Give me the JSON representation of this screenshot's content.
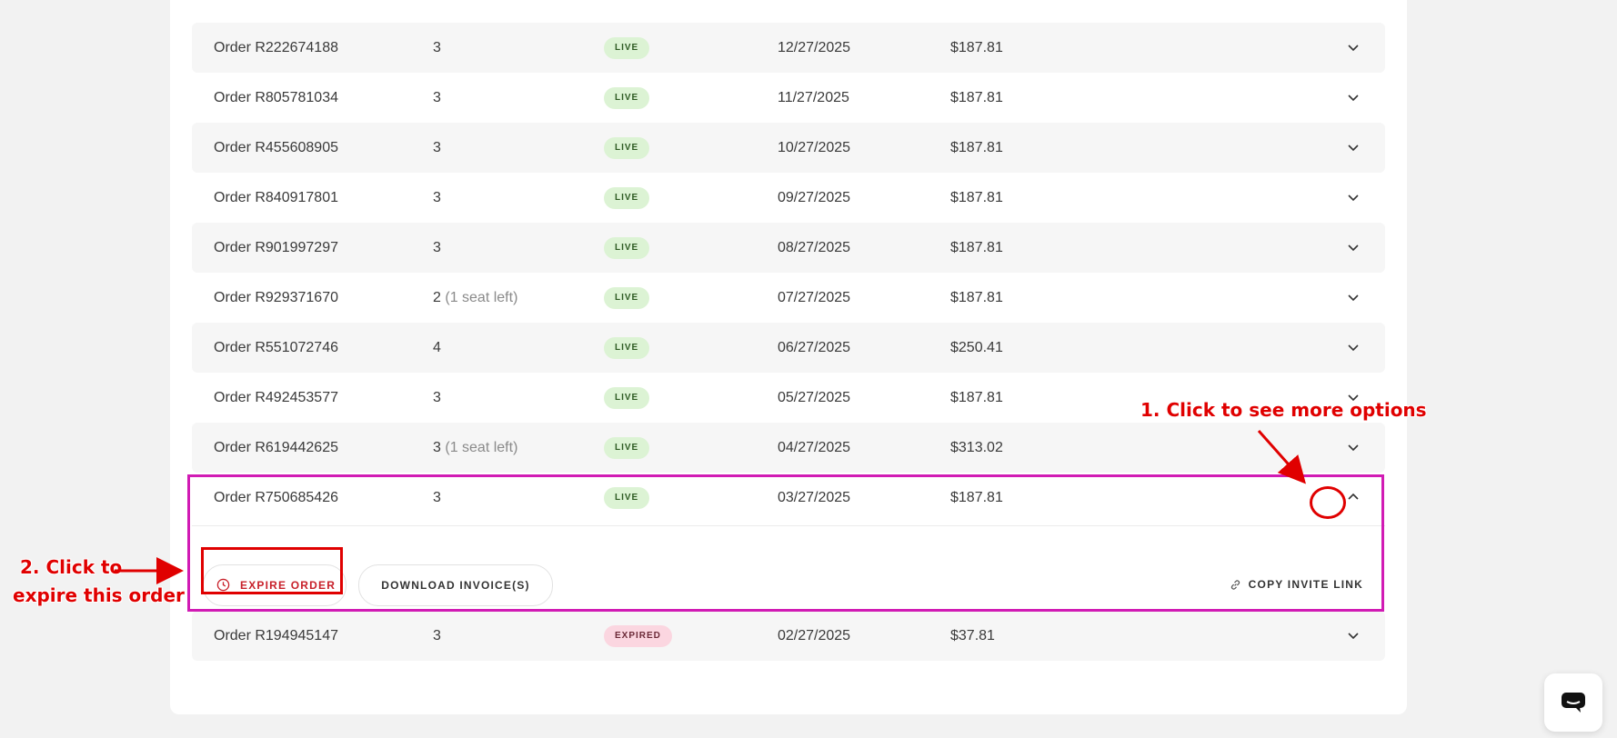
{
  "orders": [
    {
      "order": "Order R222674188",
      "seats": "3",
      "seats_left": "",
      "status": "LIVE",
      "date": "12/27/2025",
      "price": "$187.81"
    },
    {
      "order": "Order R805781034",
      "seats": "3",
      "seats_left": "",
      "status": "LIVE",
      "date": "11/27/2025",
      "price": "$187.81"
    },
    {
      "order": "Order R455608905",
      "seats": "3",
      "seats_left": "",
      "status": "LIVE",
      "date": "10/27/2025",
      "price": "$187.81"
    },
    {
      "order": "Order R840917801",
      "seats": "3",
      "seats_left": "",
      "status": "LIVE",
      "date": "09/27/2025",
      "price": "$187.81"
    },
    {
      "order": "Order R901997297",
      "seats": "3",
      "seats_left": "",
      "status": "LIVE",
      "date": "08/27/2025",
      "price": "$187.81"
    },
    {
      "order": "Order R929371670",
      "seats": "2",
      "seats_left": "(1 seat left)",
      "status": "LIVE",
      "date": "07/27/2025",
      "price": "$187.81"
    },
    {
      "order": "Order R551072746",
      "seats": "4",
      "seats_left": "",
      "status": "LIVE",
      "date": "06/27/2025",
      "price": "$250.41"
    },
    {
      "order": "Order R492453577",
      "seats": "3",
      "seats_left": "",
      "status": "LIVE",
      "date": "05/27/2025",
      "price": "$187.81"
    },
    {
      "order": "Order R619442625",
      "seats": "3",
      "seats_left": "(1 seat left)",
      "status": "LIVE",
      "date": "04/27/2025",
      "price": "$313.02"
    },
    {
      "order": "Order R750685426",
      "seats": "3",
      "seats_left": "",
      "status": "LIVE",
      "date": "03/27/2025",
      "price": "$187.81"
    },
    {
      "order": "Order R194945147",
      "seats": "3",
      "seats_left": "",
      "status": "EXPIRED",
      "date": "02/27/2025",
      "price": "$37.81"
    }
  ],
  "expanded": {
    "expire_label": "EXPIRE ORDER",
    "invoice_label": "DOWNLOAD INVOICE(S)",
    "copy_label": "COPY INVITE LINK"
  },
  "annotations": {
    "step1": "1. Click to see more options",
    "step2_line1": "2. Click to",
    "step2_line2": "expire this order"
  },
  "colors": {
    "highlight": "#d11bb4",
    "annotation": "#e00000",
    "live_badge": "#dcf3d4",
    "expired_badge": "#fbd6e0"
  }
}
